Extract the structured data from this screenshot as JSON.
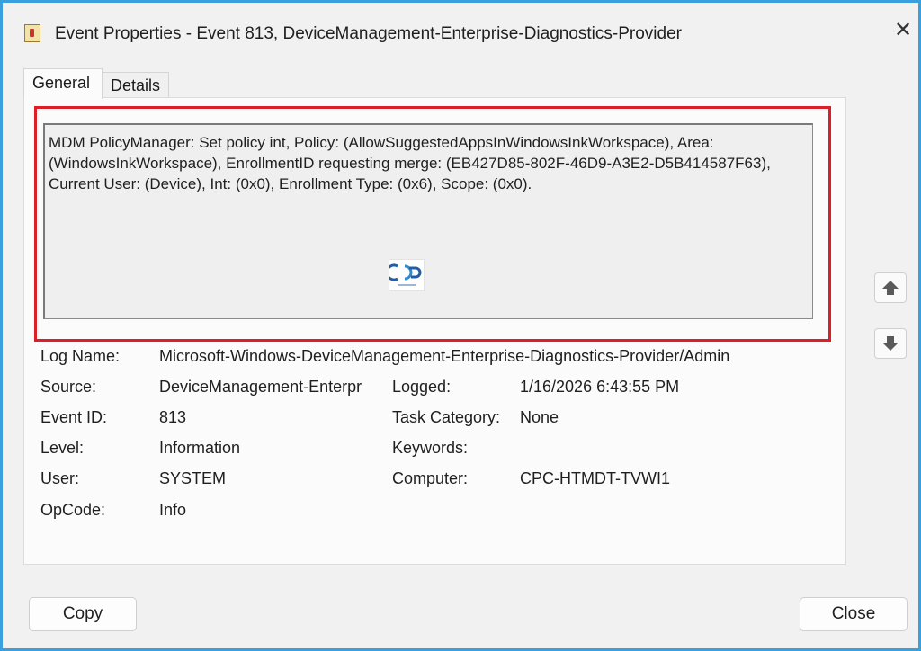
{
  "window": {
    "title": "Event Properties - Event 813, DeviceManagement-Enterprise-Diagnostics-Provider",
    "close_glyph": "✕"
  },
  "tabs": [
    {
      "label": "General",
      "selected": true
    },
    {
      "label": "Details",
      "selected": false
    }
  ],
  "description": {
    "text": "MDM PolicyManager: Set policy int, Policy: (AllowSuggestedAppsInWindowsInkWorkspace), Area: (WindowsInkWorkspace), EnrollmentID requesting merge: (EB427D85-802F-46D9-A3E2-D5B414587F63), Current User: (Device), Int: (0x0), Enrollment Type: (0x6), Scope: (0x0)."
  },
  "properties": {
    "log_name_label": "Log Name:",
    "log_name_value": "Microsoft-Windows-DeviceManagement-Enterprise-Diagnostics-Provider/Admin",
    "source_label": "Source:",
    "source_value": "DeviceManagement-Enterpr",
    "logged_label": "Logged:",
    "logged_value": "1/16/2026 6:43:55 PM",
    "event_id_label": "Event ID:",
    "event_id_value": "813",
    "task_category_label": "Task Category:",
    "task_category_value": "None",
    "level_label": "Level:",
    "level_value": "Information",
    "keywords_label": "Keywords:",
    "keywords_value": "",
    "user_label": "User:",
    "user_value": "SYSTEM",
    "computer_label": "Computer:",
    "computer_value": "CPC-HTMDT-TVWI1",
    "opcode_label": "OpCode:",
    "opcode_value": "Info"
  },
  "buttons": {
    "copy": "Copy",
    "close": "Close"
  },
  "icons": {
    "app": "event-viewer-icon",
    "up": "arrow-up-icon",
    "down": "arrow-down-icon",
    "watermark": "watermark-logo"
  },
  "colors": {
    "frame_border": "#3aa0dd",
    "highlight": "#dc1e28"
  }
}
